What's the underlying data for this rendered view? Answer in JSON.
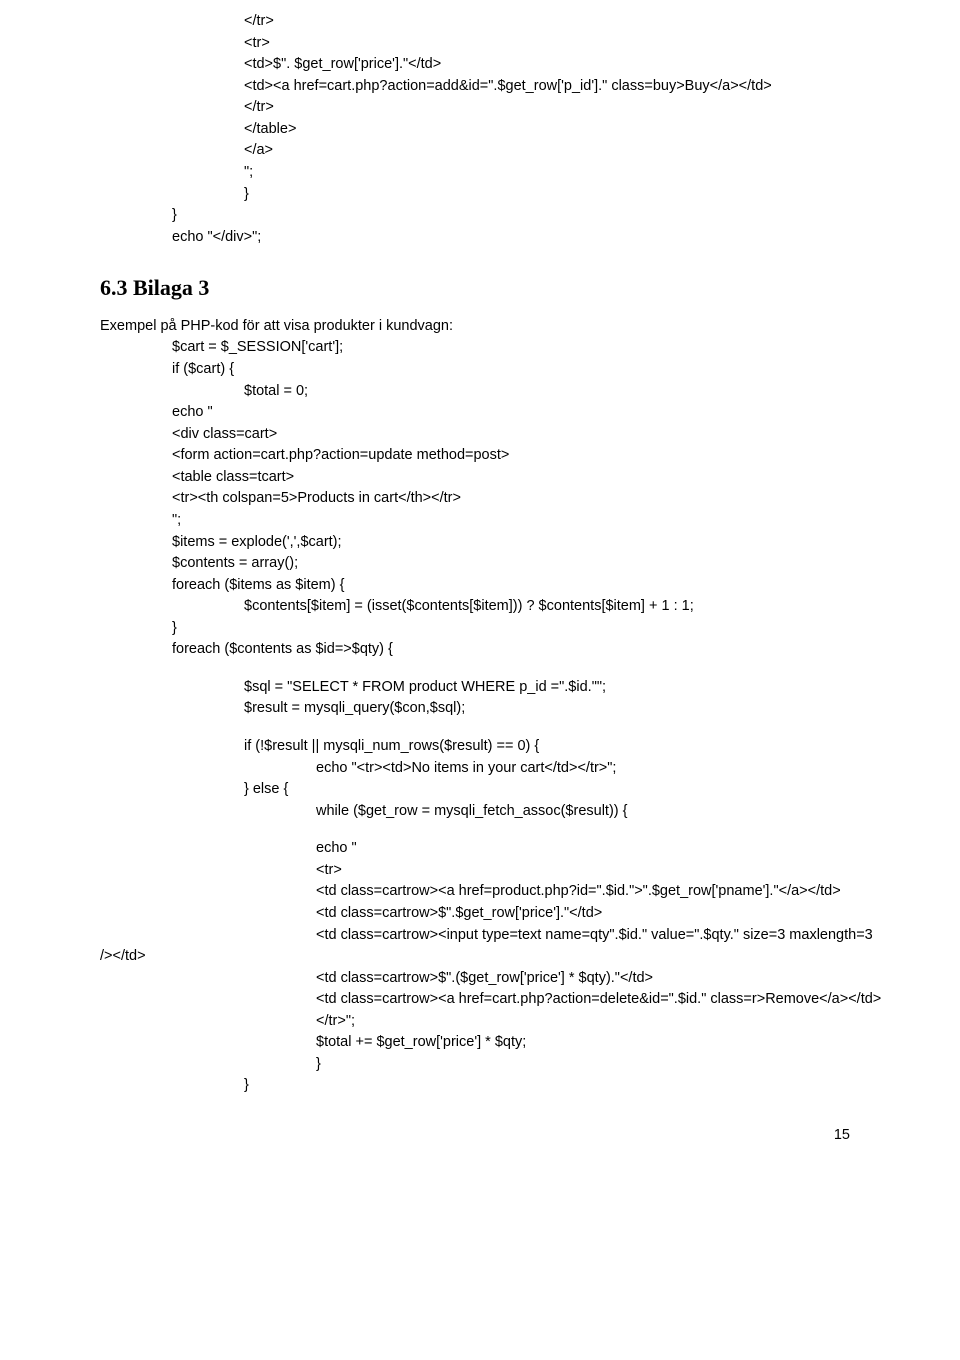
{
  "block1": {
    "l1": "</tr>",
    "l2": "<tr>",
    "l3": "<td>$\". $get_row['price'].\"</td>",
    "l4": "<td><a href=cart.php?action=add&id=\".$get_row['p_id'].\" class=buy>Buy</a></td>",
    "l5": "</tr>",
    "l6": "</table>",
    "l7": "</a>",
    "l8": "\";",
    "l9": "}"
  },
  "block1b": {
    "l1": "}",
    "l2": "echo \"</div>\";"
  },
  "heading": "6.3 Bilaga 3",
  "intro": "Exempel på PHP-kod för att visa produkter i kundvagn:",
  "block2": {
    "l1": "$cart = $_SESSION['cart'];",
    "l2": "if ($cart) {",
    "l3": "$total = 0;",
    "l4": "echo \"",
    "l5": "<div class=cart>",
    "l6": "<form action=cart.php?action=update method=post>",
    "l7": "<table class=tcart>",
    "l8": "<tr><th colspan=5>Products in cart</th></tr>",
    "l9": "\";",
    "l10": "$items = explode(',',$cart);",
    "l11": "$contents = array();",
    "l12": "foreach ($items as $item) {",
    "l13": "$contents[$item] = (isset($contents[$item])) ? $contents[$item] + 1 : 1;",
    "l14": "}",
    "l15": "foreach ($contents as $id=>$qty) {"
  },
  "block3": {
    "l1": "$sql = \"SELECT * FROM product WHERE p_id =\".$id.\"\";",
    "l2": "$result = mysqli_query($con,$sql);"
  },
  "block4": {
    "l1": "if (!$result || mysqli_num_rows($result) == 0) {",
    "l2": "echo \"<tr><td>No items in your cart</td></tr>\";",
    "l3": "} else {",
    "l4": "while ($get_row = mysqli_fetch_assoc($result)) {"
  },
  "block5": {
    "l1": "echo \"",
    "l2": "<tr>",
    "l3": "<td class=cartrow><a href=product.php?id=\".$id.\">\".$get_row['pname'].\"</a></td>",
    "l4": "<td class=cartrow>$\".$get_row['price'].\"</td>",
    "l5a": "<td class=cartrow><input type=text name=qty\".$id.\" value=\".$qty.\" size=3 maxlength=3",
    "l5b": "/></td>",
    "l6": "<td class=cartrow>$\".($get_row['price'] * $qty).\"</td>",
    "l7": "<td class=cartrow><a href=cart.php?action=delete&id=\".$id.\" class=r>Remove</a></td>",
    "l8": "</tr>\";",
    "l9": "$total += $get_row['price'] * $qty;",
    "l10": "}",
    "l11": "}"
  },
  "pagenum": "15"
}
